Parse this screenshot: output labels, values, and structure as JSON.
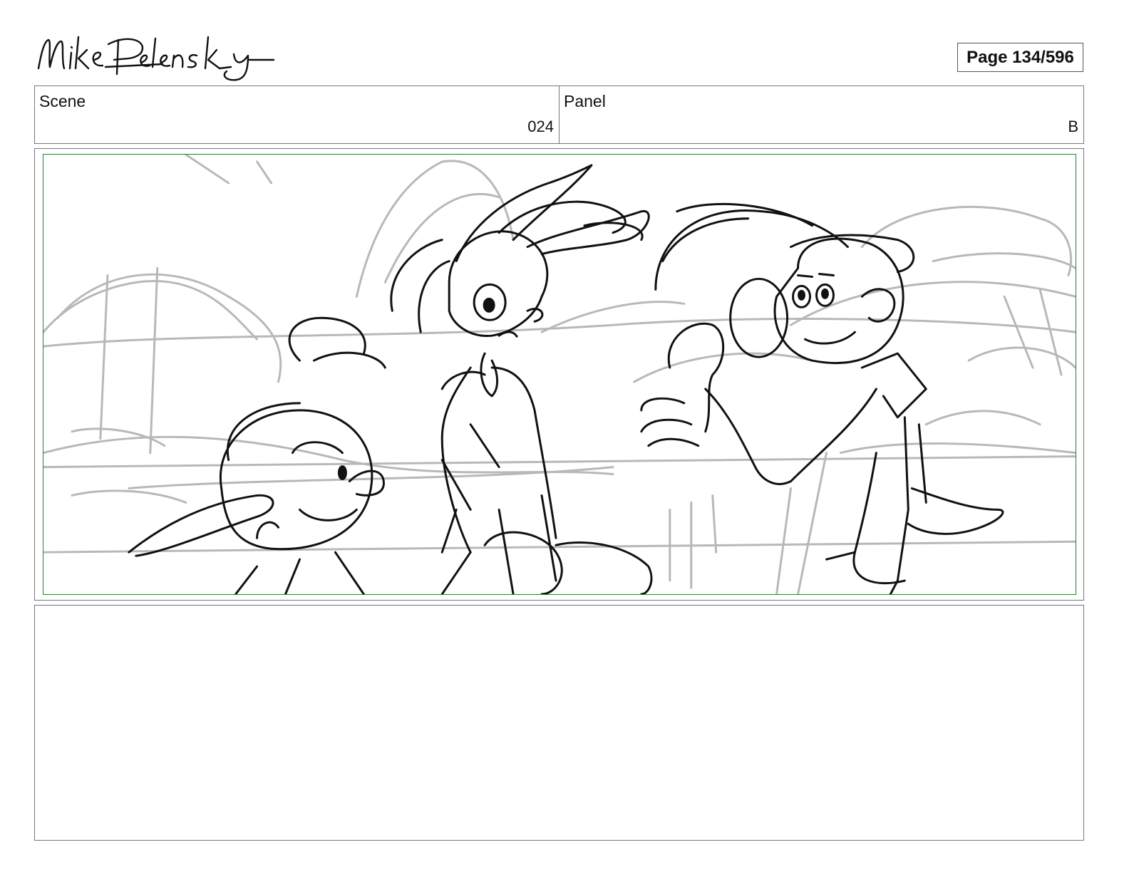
{
  "header": {
    "signature": "Mike Pelensky",
    "page_label": "Page 134/596"
  },
  "info_bar": {
    "scene_label": "Scene",
    "scene_value": "024",
    "panel_label": "Panel",
    "panel_value": "B"
  },
  "panel": {
    "safe_area_color": "#2e7d32",
    "sketch_line_color": "#111111",
    "background_sketch_color": "#b8b8b8"
  },
  "notes": {
    "text": ""
  }
}
